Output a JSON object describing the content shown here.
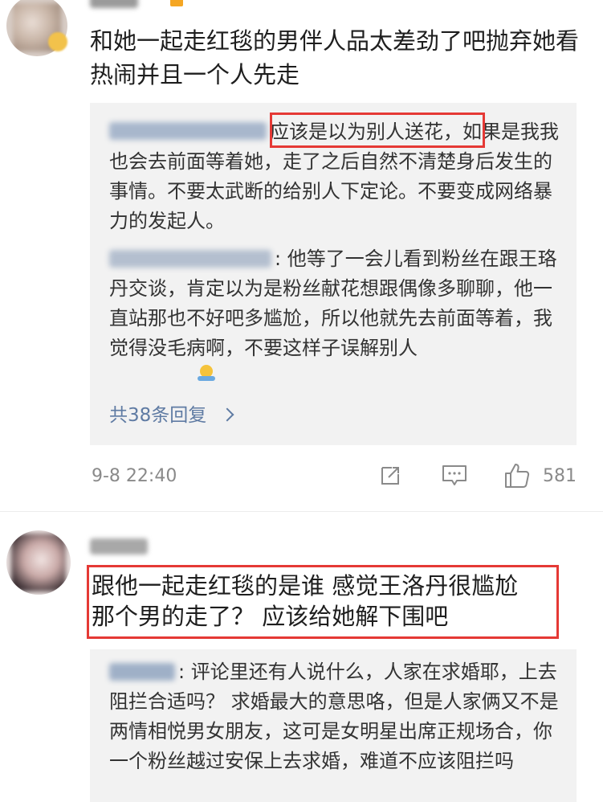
{
  "comment1": {
    "avatar_icon": "user-avatar-blurred",
    "text": "和她一起走红毯的男伴人品太差劲了吧抛弃她看热闹并且一个人先走",
    "replies": [
      {
        "text": "应该是以为别人送花，如果是我我也会去前面等着她，走了之后自然不清楚身后发生的事情。不要太武断的给别人下定论。不要变成网络暴力的发起人。"
      },
      {
        "text": ": 他等了一会儿看到粉丝在跟王珞丹交谈，肯定以为是粉丝献花想跟偶像多聊聊，他一直站那也不好吧多尴尬，所以他就先去前面等着，我觉得没毛病啊，不要这样子误解别人"
      }
    ],
    "more_replies": "共38条回复",
    "time": "9-8 22:40",
    "likes": "581"
  },
  "comment2": {
    "avatar_icon": "user-avatar-blurred",
    "text_line1": "跟他一起走红毯的是谁 感觉王洛丹很尴尬",
    "text_line2": "那个男的走了？ 应该给她解下围吧",
    "reply": {
      "text": ": 评论里还有人说什么，人家在求婚耶，上去阻拦合适吗？ 求婚最大的意思咯，但是人家俩又不是两情相悦男女朋友，这可是女明星出席正规场合，你一个粉丝越过安保上去求婚，难道不应该阻拦吗"
    }
  },
  "colors": {
    "link": "#5f7ba3",
    "highlight_box": "#e53935",
    "reply_bg": "#f2f2f2"
  }
}
